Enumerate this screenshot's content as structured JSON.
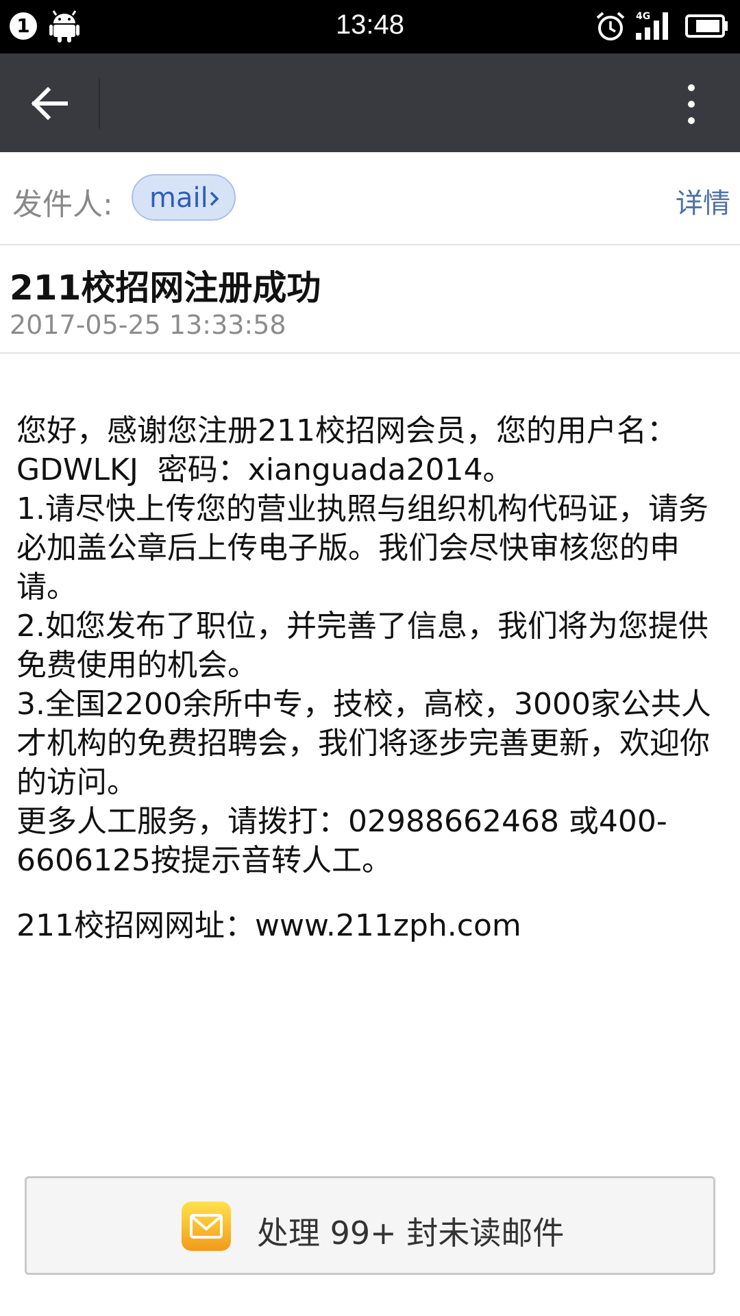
{
  "status_bar": {
    "notification_count": "1",
    "time": "13:48",
    "network": "4G",
    "icons": [
      "android-icon",
      "alarm-icon",
      "signal-icon",
      "battery-icon"
    ]
  },
  "app_bar": {
    "icons": [
      "back-arrow-icon",
      "more-vert-icon"
    ]
  },
  "sender": {
    "label": "发件人:",
    "name": "mail",
    "details_link": "详情"
  },
  "subject": {
    "title": "211校招网注册成功",
    "date": "2017-05-25 13:33:58"
  },
  "body": {
    "paragraphs": [
      "您好，感谢您注册211校招网会员，您的用户名：GDWLKJ  密码：xianguada2014。",
      "1.请尽快上传您的营业执照与组织机构代码证，请务必加盖公章后上传电子版。我们会尽快审核您的申请。",
      "2.如您发布了职位，并完善了信息，我们将为您提供免费使用的机会。",
      "3.全国2200余所中专，技校，高校，3000家公共人才机构的免费招聘会，我们将逐步完善更新，欢迎你的访问。",
      "更多人工服务，请拨打：02988662468 或400-6606125按提示音转人工。"
    ],
    "website_line": "211校招网网址：www.211zph.com"
  },
  "unread_button": {
    "label": "处理 99+ 封未读邮件",
    "icon": "mail-icon"
  },
  "colors": {
    "status_bar_bg": "#000000",
    "app_bar_bg": "#393a3f",
    "link": "#4d6fa8",
    "chip_bg": "#d6e3f7"
  }
}
